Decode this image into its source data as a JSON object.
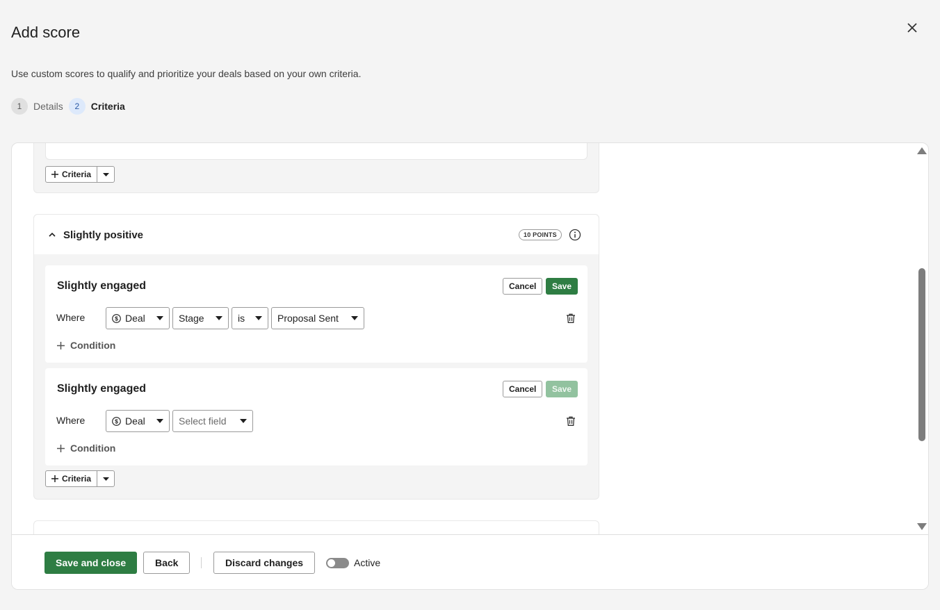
{
  "dialog": {
    "title": "Add score",
    "subtitle": "Use custom scores to qualify and prioritize your deals based on your own criteria."
  },
  "stepper": {
    "steps": [
      {
        "number": "1",
        "label": "Details"
      },
      {
        "number": "2",
        "label": "Criteria"
      }
    ]
  },
  "criteria_button_label": "Criteria",
  "groups": [
    {
      "title": "Slightly positive",
      "points": "10 POINTS",
      "rules": [
        {
          "title": "Slightly engaged",
          "cancel_label": "Cancel",
          "save_label": "Save",
          "save_enabled": true,
          "where_label": "Where",
          "entity": "Deal",
          "field": "Stage",
          "operator": "is",
          "value": "Proposal Sent",
          "add_condition_label": "Condition"
        },
        {
          "title": "Slightly engaged",
          "cancel_label": "Cancel",
          "save_label": "Save",
          "save_enabled": false,
          "where_label": "Where",
          "entity": "Deal",
          "field_placeholder": "Select field",
          "add_condition_label": "Condition"
        }
      ]
    }
  ],
  "footer": {
    "save_close_label": "Save and close",
    "back_label": "Back",
    "discard_label": "Discard changes",
    "active_label": "Active",
    "active_on": false
  },
  "colors": {
    "primary_green": "#2e7d43",
    "disabled_green": "#92c29f",
    "step_current_bg": "#dde9fb"
  }
}
